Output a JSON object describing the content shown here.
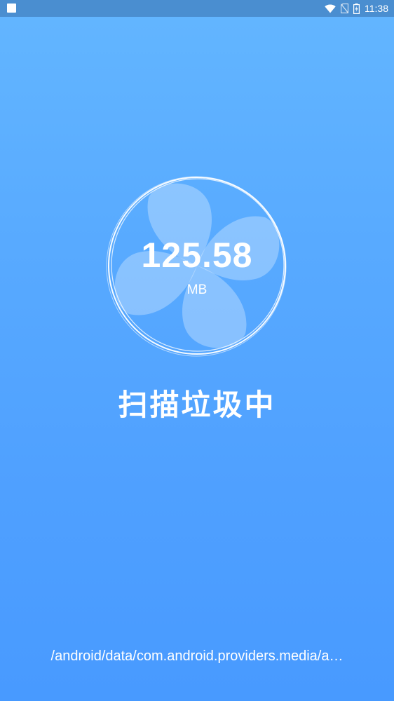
{
  "status_bar": {
    "time": "11:38",
    "icons": [
      "notification-icon",
      "wifi-icon",
      "no-sim-icon",
      "battery-charging-icon"
    ]
  },
  "scan": {
    "size_value": "125.58",
    "size_unit": "MB",
    "status_text": "扫描垃圾中",
    "current_path": "/android/data/com.android.providers.media/a…"
  },
  "colors": {
    "background_top": "#63b6ff",
    "background_bottom": "#489aff",
    "status_bar": "#4a8ed0",
    "text": "#ffffff"
  }
}
